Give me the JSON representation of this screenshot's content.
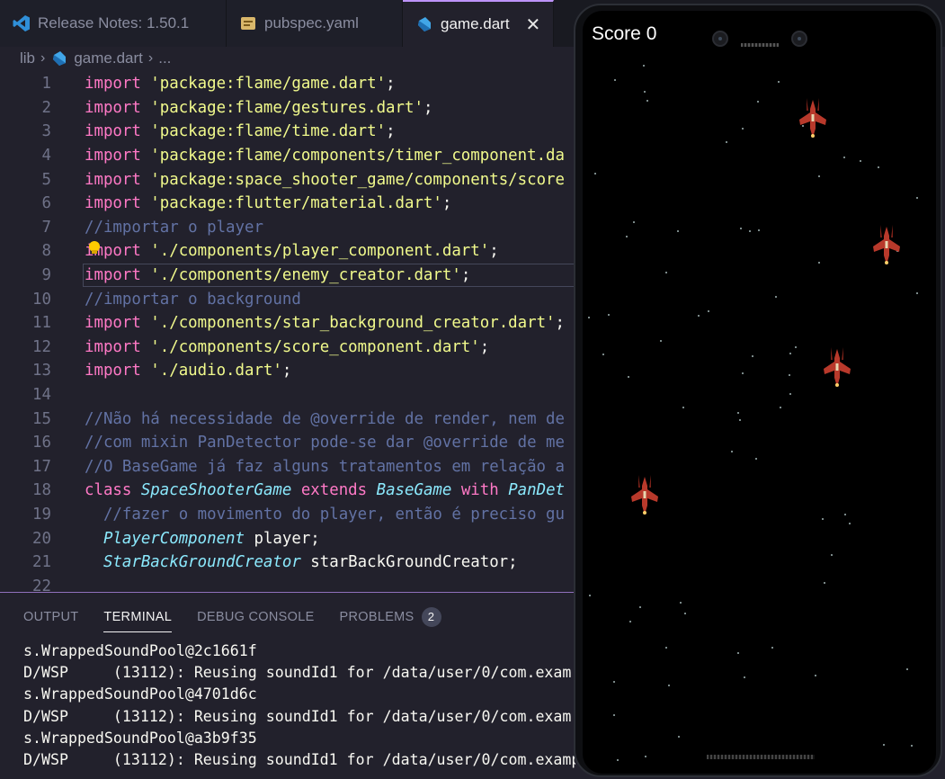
{
  "tabs": [
    {
      "label": "Release Notes: 1.50.1",
      "icon": "vscode-icon",
      "active": false
    },
    {
      "label": "pubspec.yaml",
      "icon": "yaml-file-icon",
      "active": false
    },
    {
      "label": "game.dart",
      "icon": "dart-file-icon",
      "active": true,
      "close": "✕"
    }
  ],
  "breadcrumb": {
    "folder": "lib",
    "file": "game.dart",
    "more": "..."
  },
  "editor": {
    "lines": [
      {
        "n": "1",
        "parts": [
          [
            "kw",
            "import "
          ],
          [
            "str",
            "'package:flame/game.dart'"
          ],
          [
            "tx",
            ";"
          ]
        ]
      },
      {
        "n": "2",
        "parts": [
          [
            "kw",
            "import "
          ],
          [
            "str",
            "'package:flame/gestures.dart'"
          ],
          [
            "tx",
            ";"
          ]
        ]
      },
      {
        "n": "3",
        "parts": [
          [
            "kw",
            "import "
          ],
          [
            "str",
            "'package:flame/time.dart'"
          ],
          [
            "tx",
            ";"
          ]
        ]
      },
      {
        "n": "4",
        "parts": [
          [
            "kw",
            "import "
          ],
          [
            "str",
            "'package:flame/components/timer_component.da"
          ]
        ]
      },
      {
        "n": "5",
        "parts": [
          [
            "kw",
            "import "
          ],
          [
            "str",
            "'package:space_shooter_game/components/score"
          ]
        ]
      },
      {
        "n": "6",
        "parts": [
          [
            "kw",
            "import "
          ],
          [
            "str",
            "'package:flutter/material.dart'"
          ],
          [
            "tx",
            ";"
          ]
        ]
      },
      {
        "n": "7",
        "parts": [
          [
            "cm",
            "//importar o player"
          ]
        ]
      },
      {
        "n": "8",
        "parts": [
          [
            "kw",
            "import "
          ],
          [
            "str",
            "'./components/player_component.dart'"
          ],
          [
            "tx",
            ";"
          ]
        ]
      },
      {
        "n": "9",
        "parts": [
          [
            "kw",
            "import "
          ],
          [
            "str",
            "'./components/enemy_creator.dart'"
          ],
          [
            "tx",
            ";"
          ]
        ],
        "current": true
      },
      {
        "n": "10",
        "parts": [
          [
            "cm",
            "//importar o background"
          ]
        ]
      },
      {
        "n": "11",
        "parts": [
          [
            "kw",
            "import "
          ],
          [
            "str",
            "'./components/star_background_creator.dart'"
          ],
          [
            "tx",
            ";"
          ]
        ]
      },
      {
        "n": "12",
        "parts": [
          [
            "kw",
            "import "
          ],
          [
            "str",
            "'./components/score_component.dart'"
          ],
          [
            "tx",
            ";"
          ]
        ]
      },
      {
        "n": "13",
        "parts": [
          [
            "kw",
            "import "
          ],
          [
            "str",
            "'./audio.dart'"
          ],
          [
            "tx",
            ";"
          ]
        ]
      },
      {
        "n": "14",
        "parts": []
      },
      {
        "n": "15",
        "parts": [
          [
            "cm",
            "//Não há necessidade de @override de render, nem de"
          ]
        ]
      },
      {
        "n": "16",
        "parts": [
          [
            "cm",
            "//com mixin PanDetector pode-se dar @override de me"
          ]
        ]
      },
      {
        "n": "17",
        "parts": [
          [
            "cm",
            "//O BaseGame já faz alguns tratamentos em relação a"
          ]
        ]
      },
      {
        "n": "18",
        "parts": [
          [
            "kw",
            "class "
          ],
          [
            "ty",
            "SpaceShooterGame "
          ],
          [
            "kw",
            "extends "
          ],
          [
            "ty",
            "BaseGame "
          ],
          [
            "kw",
            "with "
          ],
          [
            "ty",
            "PanDet"
          ]
        ]
      },
      {
        "n": "19",
        "parts": [
          [
            "cm",
            "  //fazer o movimento do player, então é preciso gu"
          ]
        ]
      },
      {
        "n": "20",
        "parts": [
          [
            "ty",
            "  PlayerComponent "
          ],
          [
            "tx",
            "player;"
          ]
        ]
      },
      {
        "n": "21",
        "parts": [
          [
            "ty",
            "  StarBackGroundCreator "
          ],
          [
            "tx",
            "starBackGroundCreator;"
          ]
        ]
      },
      {
        "n": "22",
        "parts": []
      }
    ]
  },
  "panel": {
    "tabs": [
      {
        "label": "OUTPUT",
        "active": false
      },
      {
        "label": "TERMINAL",
        "active": true
      },
      {
        "label": "DEBUG CONSOLE",
        "active": false
      },
      {
        "label": "PROBLEMS",
        "active": false,
        "badge": "2"
      }
    ],
    "terminal_lines": [
      "s.WrappedSoundPool@2c1661f",
      "D/WSP     (13112): Reusing soundId1 for /data/user/0/com.exam",
      "s.WrappedSoundPool@4701d6c",
      "D/WSP     (13112): Reusing soundId1 for /data/user/0/com.exam",
      "s.WrappedSoundPool@a3b9f35",
      "D/WSP     (13112): Reusing soundId1 for /data/user/0/com.examp"
    ]
  },
  "game": {
    "score_label": "Score 0",
    "enemy_count": 4
  },
  "colors": {
    "accent": "#bd93f9",
    "keyword": "#ff79c6",
    "string": "#f1fa8c",
    "comment": "#6272a4",
    "type": "#8be9fd",
    "ship_red": "#b8392b"
  }
}
